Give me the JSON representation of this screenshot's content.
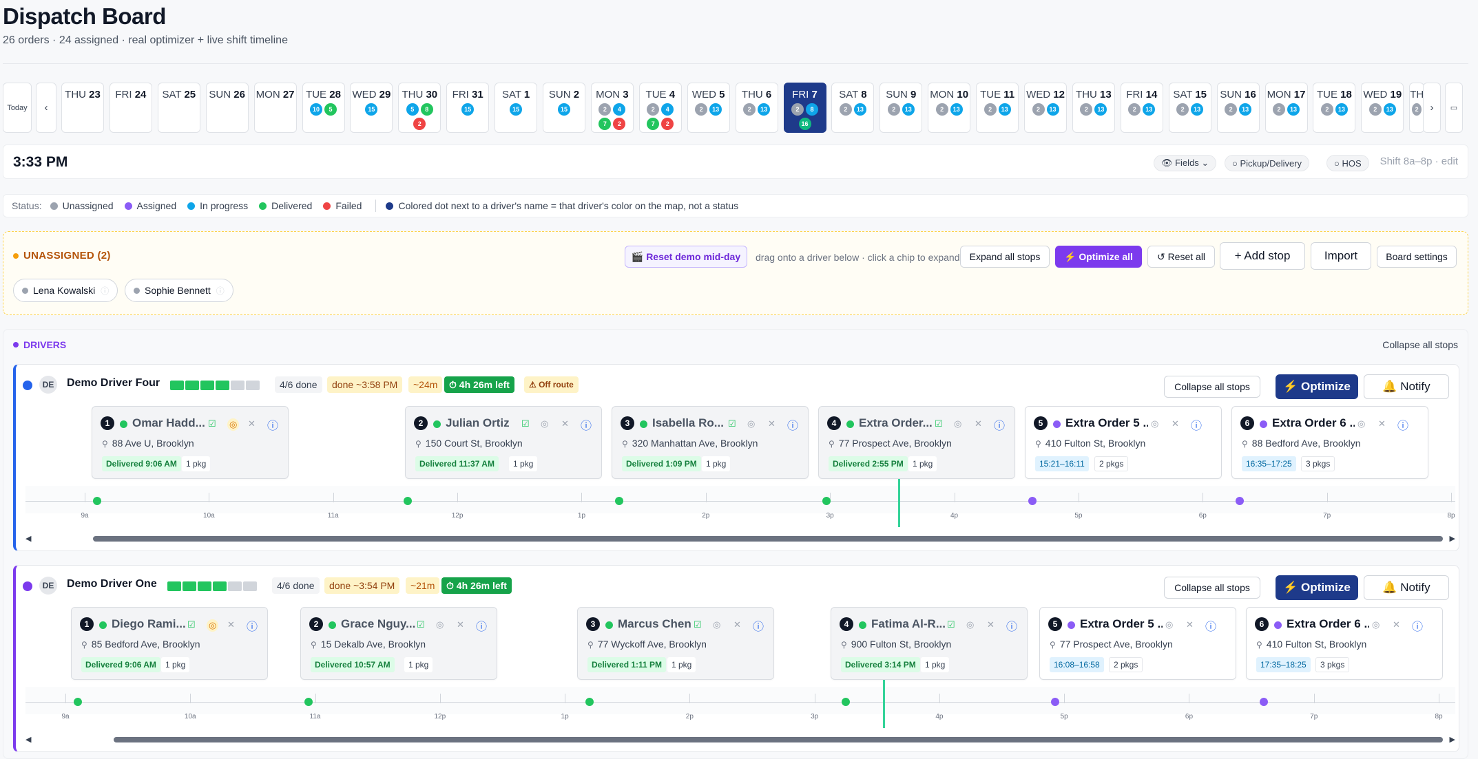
{
  "header": {
    "title": "Dispatch Board",
    "subtitle": "26 orders · 24 assigned · real optimizer + live shift timeline"
  },
  "datebar": {
    "today_label": "Today",
    "prev_label": "‹",
    "next_label": "›",
    "calendar_icon": "calendar-icon",
    "days": [
      {
        "dow": "THU",
        "day": "23",
        "badges": []
      },
      {
        "dow": "FRI",
        "day": "24",
        "badges": []
      },
      {
        "dow": "SAT",
        "day": "25",
        "badges": []
      },
      {
        "dow": "SUN",
        "day": "26",
        "badges": []
      },
      {
        "dow": "MON",
        "day": "27",
        "badges": []
      },
      {
        "dow": "TUE",
        "day": "28",
        "badges": [
          [
            "10",
            "blue"
          ],
          [
            "5",
            "green"
          ]
        ]
      },
      {
        "dow": "WED",
        "day": "29",
        "badges": [
          [
            "15",
            "blue"
          ]
        ]
      },
      {
        "dow": "THU",
        "day": "30",
        "badges": [
          [
            "5",
            "blue"
          ],
          [
            "8",
            "green"
          ],
          [
            "2",
            "red"
          ]
        ]
      },
      {
        "dow": "FRI",
        "day": "31",
        "badges": [
          [
            "15",
            "blue"
          ]
        ]
      },
      {
        "dow": "SAT",
        "day": "1",
        "badges": [
          [
            "15",
            "blue"
          ]
        ]
      },
      {
        "dow": "SUN",
        "day": "2",
        "badges": [
          [
            "15",
            "blue"
          ]
        ]
      },
      {
        "dow": "MON",
        "day": "3",
        "badges": [
          [
            "2",
            "gray"
          ],
          [
            "4",
            "blue"
          ],
          [
            "7",
            "green"
          ],
          [
            "2",
            "red"
          ]
        ]
      },
      {
        "dow": "TUE",
        "day": "4",
        "badges": [
          [
            "2",
            "gray"
          ],
          [
            "4",
            "blue"
          ],
          [
            "7",
            "green"
          ],
          [
            "2",
            "red"
          ]
        ]
      },
      {
        "dow": "WED",
        "day": "5",
        "badges": [
          [
            "2",
            "gray"
          ],
          [
            "13",
            "blue"
          ]
        ]
      },
      {
        "dow": "THU",
        "day": "6",
        "badges": [
          [
            "2",
            "gray"
          ],
          [
            "13",
            "blue"
          ]
        ]
      },
      {
        "dow": "FRI",
        "day": "7",
        "badges": [
          [
            "2",
            "gray"
          ],
          [
            "8",
            "blue"
          ],
          [
            "16",
            "green2"
          ]
        ],
        "selected": true
      },
      {
        "dow": "SAT",
        "day": "8",
        "badges": [
          [
            "2",
            "gray"
          ],
          [
            "13",
            "blue"
          ]
        ]
      },
      {
        "dow": "SUN",
        "day": "9",
        "badges": [
          [
            "2",
            "gray"
          ],
          [
            "13",
            "blue"
          ]
        ]
      },
      {
        "dow": "MON",
        "day": "10",
        "badges": [
          [
            "2",
            "gray"
          ],
          [
            "13",
            "blue"
          ]
        ]
      },
      {
        "dow": "TUE",
        "day": "11",
        "badges": [
          [
            "2",
            "gray"
          ],
          [
            "13",
            "blue"
          ]
        ]
      },
      {
        "dow": "WED",
        "day": "12",
        "badges": [
          [
            "2",
            "gray"
          ],
          [
            "13",
            "blue"
          ]
        ]
      },
      {
        "dow": "THU",
        "day": "13",
        "badges": [
          [
            "2",
            "gray"
          ],
          [
            "13",
            "blue"
          ]
        ]
      },
      {
        "dow": "FRI",
        "day": "14",
        "badges": [
          [
            "2",
            "gray"
          ],
          [
            "13",
            "blue"
          ]
        ]
      },
      {
        "dow": "SAT",
        "day": "15",
        "badges": [
          [
            "2",
            "gray"
          ],
          [
            "13",
            "blue"
          ]
        ]
      },
      {
        "dow": "SUN",
        "day": "16",
        "badges": [
          [
            "2",
            "gray"
          ],
          [
            "13",
            "blue"
          ]
        ]
      },
      {
        "dow": "MON",
        "day": "17",
        "badges": [
          [
            "2",
            "gray"
          ],
          [
            "13",
            "blue"
          ]
        ]
      },
      {
        "dow": "TUE",
        "day": "18",
        "badges": [
          [
            "2",
            "gray"
          ],
          [
            "13",
            "blue"
          ]
        ]
      },
      {
        "dow": "WED",
        "day": "19",
        "badges": [
          [
            "2",
            "gray"
          ],
          [
            "13",
            "blue"
          ]
        ]
      },
      {
        "dow": "TH",
        "day": "",
        "badges": [
          [
            "2",
            "gray"
          ]
        ]
      }
    ]
  },
  "timebar": {
    "time": "3:33 PM",
    "fields_label": "👁 Fields ⌄",
    "pickup_label": "○ Pickup/Delivery",
    "hos_label": "○ HOS",
    "shift_label": "Shift 8a–8p · edit"
  },
  "status_legend": {
    "label": "Status:",
    "items": [
      {
        "text": "Unassigned",
        "color": "#9ca3af"
      },
      {
        "text": "Assigned",
        "color": "#8b5cf6"
      },
      {
        "text": "In progress",
        "color": "#0ea5e9"
      },
      {
        "text": "Delivered",
        "color": "#22c55e"
      },
      {
        "text": "Failed",
        "color": "#ef4444"
      }
    ],
    "note": "Colored dot next to a driver's name = that driver's color on the map, not a status",
    "note_color": "#1e3a8a"
  },
  "unassigned": {
    "title": "UNASSIGNED (2)",
    "reset_demo_label": "🎬 Reset demo mid-day",
    "hint": "drag onto a driver below · click a chip to expand",
    "expand_all_label": "Expand all stops",
    "optimize_all_label": "⚡ Optimize all",
    "reset_all_label": "↺ Reset all",
    "add_stop_label": "+ Add stop",
    "import_label": "Import",
    "board_settings_label": "Board settings",
    "chips": [
      "Lena Kowalski",
      "Sophie Bennett"
    ]
  },
  "drivers_section": {
    "title": "DRIVERS",
    "collapse_all_label": "Collapse all stops",
    "timeline_labels": [
      "9a",
      "10a",
      "11a",
      "12p",
      "1p",
      "2p",
      "3p",
      "4p",
      "5p",
      "6p",
      "7p",
      "8p"
    ],
    "drivers": [
      {
        "name": "Demo Driver Four",
        "initials": "DE",
        "color": "#2563eb",
        "progress_done": 4,
        "progress_total": 6,
        "done_label": "4/6 done",
        "eta_label": "done ~3:58 PM",
        "remain_label": "~24m",
        "left_label": "⏱ 4h 26m left",
        "warn_label": "⚠ Off route",
        "collapse_label": "Collapse all stops",
        "optimize_label": "⚡ Optimize",
        "notify_label": "🔔 Notify",
        "stops": [
          {
            "n": "1",
            "name": "Omar Hadd...",
            "addr": "88 Ave U, Brooklyn",
            "badge": "Delivered 9:06 AM",
            "pkg": "1 pkg",
            "status": "delivered"
          },
          {
            "n": "2",
            "name": "Julian Ortiz",
            "addr": "150 Court St, Brooklyn",
            "badge": "Delivered 11:37 AM",
            "pkg": "1 pkg",
            "status": "delivered"
          },
          {
            "n": "3",
            "name": "Isabella Ro...",
            "addr": "320 Manhattan Ave, Brooklyn",
            "badge": "Delivered 1:09 PM",
            "pkg": "1 pkg",
            "status": "delivered"
          },
          {
            "n": "4",
            "name": "Extra Order...",
            "addr": "77 Prospect Ave, Brooklyn",
            "badge": "Delivered 2:55 PM",
            "pkg": "1 pkg",
            "status": "delivered"
          },
          {
            "n": "5",
            "name": "Extra Order 5 ...",
            "addr": "410 Fulton St, Brooklyn",
            "badge": "15:21–16:11",
            "pkg": "2 pkgs",
            "status": "assigned"
          },
          {
            "n": "6",
            "name": "Extra Order 6 ...",
            "addr": "88 Bedford Ave, Brooklyn",
            "badge": "16:35–17:25",
            "pkg": "3 pkgs",
            "status": "assigned"
          }
        ],
        "timeline_points": [
          {
            "hour": 9.1,
            "status": "delivered"
          },
          {
            "hour": 11.6,
            "status": "delivered"
          },
          {
            "hour": 13.3,
            "status": "delivered"
          },
          {
            "hour": 14.97,
            "status": "delivered"
          },
          {
            "hour": 16.63,
            "status": "assigned"
          },
          {
            "hour": 18.3,
            "status": "assigned"
          }
        ],
        "now_hour": 15.55
      },
      {
        "name": "Demo Driver One",
        "initials": "DE",
        "color": "#7c3aed",
        "progress_done": 4,
        "progress_total": 6,
        "done_label": "4/6 done",
        "eta_label": "done ~3:54 PM",
        "remain_label": "~21m",
        "left_label": "⏱ 4h 26m left",
        "warn_label": "",
        "collapse_label": "Collapse all stops",
        "optimize_label": "⚡ Optimize",
        "notify_label": "🔔 Notify",
        "stops": [
          {
            "n": "1",
            "name": "Diego Rami...",
            "addr": "85 Bedford Ave, Brooklyn",
            "badge": "Delivered 9:06 AM",
            "pkg": "1 pkg",
            "status": "delivered"
          },
          {
            "n": "2",
            "name": "Grace Nguy...",
            "addr": "15 Dekalb Ave, Brooklyn",
            "badge": "Delivered 10:57 AM",
            "pkg": "1 pkg",
            "status": "delivered"
          },
          {
            "n": "3",
            "name": "Marcus Chen",
            "addr": "77 Wyckoff Ave, Brooklyn",
            "badge": "Delivered 1:11 PM",
            "pkg": "1 pkg",
            "status": "delivered"
          },
          {
            "n": "4",
            "name": "Fatima Al-R...",
            "addr": "900 Fulton St, Brooklyn",
            "badge": "Delivered 3:14 PM",
            "pkg": "1 pkg",
            "status": "delivered"
          },
          {
            "n": "5",
            "name": "Extra Order 5 ...",
            "addr": "77 Prospect Ave, Brooklyn",
            "badge": "16:08–16:58",
            "pkg": "2 pkgs",
            "status": "assigned"
          },
          {
            "n": "6",
            "name": "Extra Order 6 ...",
            "addr": "410 Fulton St, Brooklyn",
            "badge": "17:35–18:25",
            "pkg": "3 pkgs",
            "status": "assigned"
          }
        ],
        "timeline_points": [
          {
            "hour": 9.1,
            "status": "delivered"
          },
          {
            "hour": 10.95,
            "status": "delivered"
          },
          {
            "hour": 13.2,
            "status": "delivered"
          },
          {
            "hour": 15.25,
            "status": "delivered"
          },
          {
            "hour": 16.93,
            "status": "assigned"
          },
          {
            "hour": 18.6,
            "status": "assigned"
          }
        ],
        "now_hour": 15.55
      }
    ]
  }
}
